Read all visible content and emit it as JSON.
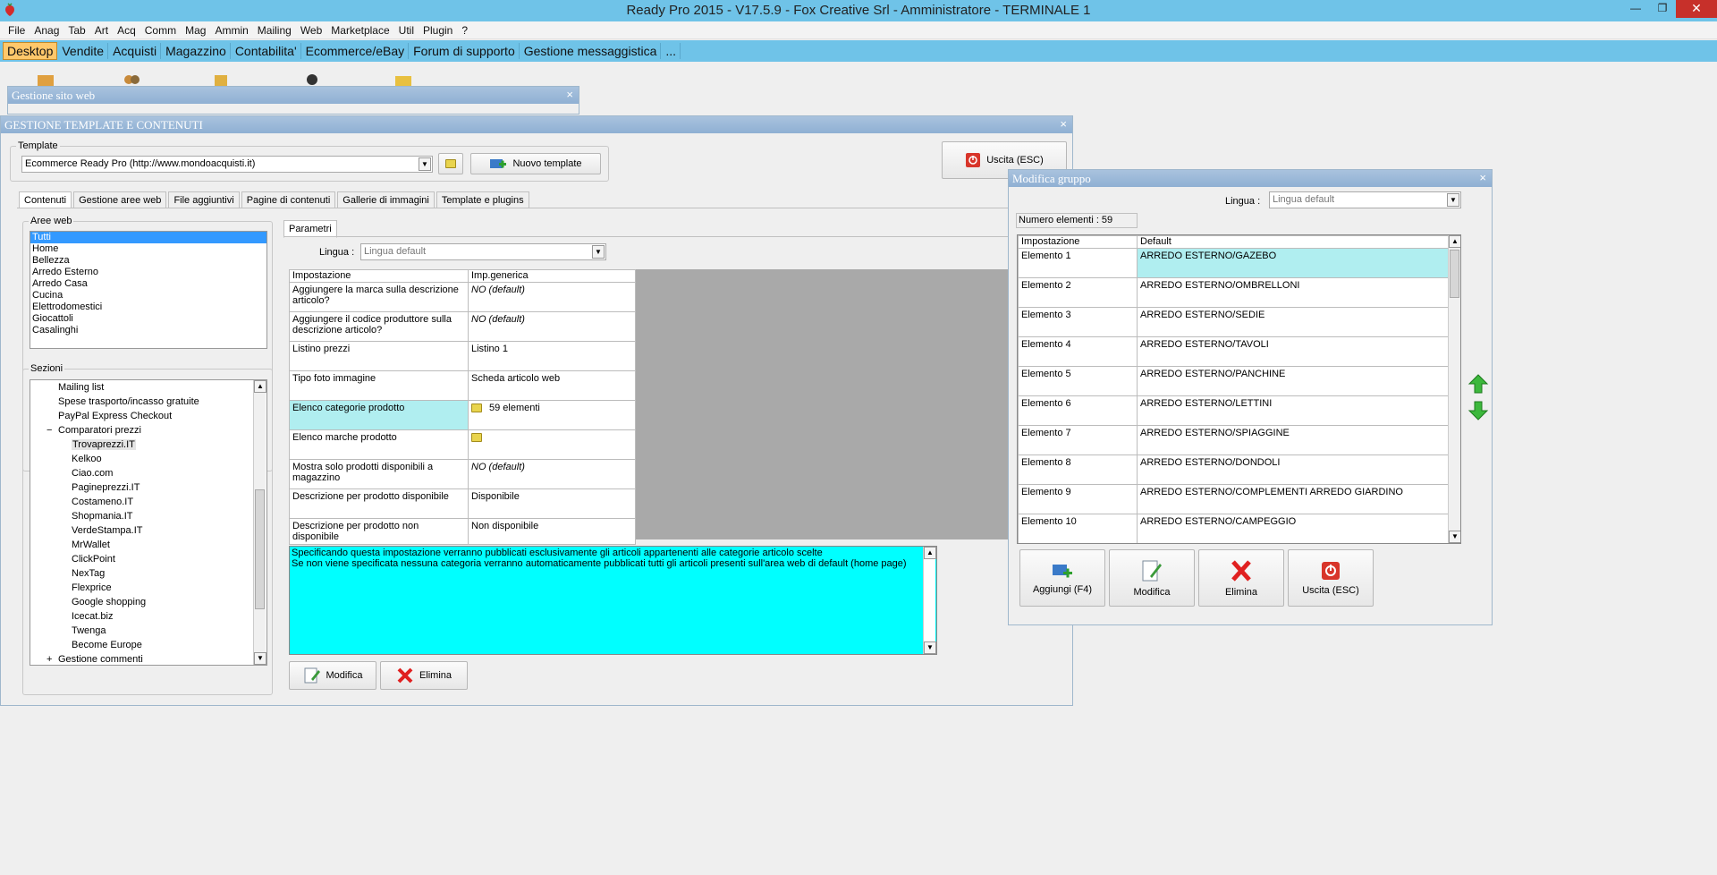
{
  "app": {
    "title": "Ready Pro 2015 - V17.5.9 - Fox Creative Srl - Amministratore - TERMINALE 1",
    "window_buttons": [
      "—",
      "❐",
      "✕"
    ]
  },
  "menu": [
    "File",
    "Anag",
    "Tab",
    "Art",
    "Acq",
    "Comm",
    "Mag",
    "Ammin",
    "Mailing",
    "Web",
    "Marketplace",
    "Util",
    "Plugin",
    "?"
  ],
  "tabs": [
    "Desktop",
    "Vendite",
    "Acquisti",
    "Magazzino",
    "Contabilita'",
    "Ecommerce/eBay",
    "Forum di supporto",
    "Gestione messaggistica",
    "..."
  ],
  "sito_web": {
    "title": "Gestione sito web",
    "close": "×"
  },
  "main_window": {
    "title": "GESTIONE TEMPLATE E CONTENUTI",
    "close": "×",
    "template_group_label": "Template",
    "template_value": "Ecommerce Ready Pro (http://www.mondoacquisti.it)",
    "nuovo_template": "Nuovo template",
    "uscita": "Uscita (ESC)",
    "subtabs": [
      "Contenuti",
      "Gestione aree web",
      "File aggiuntivi",
      "Pagine di contenuti",
      "Gallerie di immagini",
      "Template e plugins"
    ],
    "aree_web_label": "Aree web",
    "aree_web": [
      "Tutti",
      "Home",
      "Bellezza",
      "Arredo Esterno",
      "Arredo Casa",
      "Cucina",
      "Elettrodomestici",
      "Giocattoli",
      "Casalinghi"
    ],
    "sezioni_label": "Sezioni",
    "sezioni": [
      {
        "label": "Mailing list",
        "level": 1
      },
      {
        "label": "Spese trasporto/incasso gratuite",
        "level": 1
      },
      {
        "label": "PayPal Express Checkout",
        "level": 1
      },
      {
        "label": "Comparatori prezzi",
        "level": 1,
        "expander": "−"
      },
      {
        "label": "Trovaprezzi.IT",
        "level": 2,
        "selected": true
      },
      {
        "label": "Kelkoo",
        "level": 2
      },
      {
        "label": "Ciao.com",
        "level": 2
      },
      {
        "label": "Pagineprezzi.IT",
        "level": 2
      },
      {
        "label": "Costameno.IT",
        "level": 2
      },
      {
        "label": "Shopmania.IT",
        "level": 2
      },
      {
        "label": "VerdeStampa.IT",
        "level": 2
      },
      {
        "label": "MrWallet",
        "level": 2
      },
      {
        "label": "ClickPoint",
        "level": 2
      },
      {
        "label": "NexTag",
        "level": 2
      },
      {
        "label": "Flexprice",
        "level": 2
      },
      {
        "label": "Google shopping",
        "level": 2
      },
      {
        "label": "Icecat.biz",
        "level": 2
      },
      {
        "label": "Twenga",
        "level": 2
      },
      {
        "label": "Become Europe",
        "level": 2
      },
      {
        "label": "Gestione commenti",
        "level": 1,
        "expander": "+"
      }
    ],
    "parametri_tab": "Parametri",
    "lingua_label": "Lingua :",
    "lingua_value": "Lingua default",
    "param_headers": [
      "Impostazione",
      "Imp.generica"
    ],
    "params": [
      {
        "name": "Aggiungere la marca sulla descrizione articolo?",
        "value": "NO (default)",
        "italic": true
      },
      {
        "name": "Aggiungere il codice produttore sulla descrizione articolo?",
        "value": "NO (default)",
        "italic": true
      },
      {
        "name": "Listino prezzi",
        "value": "Listino 1"
      },
      {
        "name": "Tipo foto immagine",
        "value": "Scheda articolo web"
      },
      {
        "name": "Elenco categorie prodotto",
        "value": "59 elementi",
        "folder": true,
        "highlight": true
      },
      {
        "name": "Elenco marche prodotto",
        "value": "",
        "folder": true
      },
      {
        "name": "Mostra solo prodotti disponibili a magazzino",
        "value": "NO (default)",
        "italic": true
      },
      {
        "name": "Descrizione per prodotto disponibile",
        "value": "Disponibile"
      },
      {
        "name": "Descrizione per prodotto non disponibile",
        "value": "Non disponibile"
      }
    ],
    "help_line1": "Specificando questa impostazione verranno pubblicati esclusivamente gli articoli appartenenti alle categorie articolo scelte",
    "help_line2": "Se non viene specificata nessuna categoria verranno automaticamente pubblicati tutti gli articoli presenti sull'area web di default (home page)",
    "modifica": "Modifica",
    "elimina": "Elimina"
  },
  "group_window": {
    "title": "Modifica gruppo",
    "close": "×",
    "lingua_label": "Lingua :",
    "lingua_value": "Lingua default",
    "count": "Numero elementi : 59",
    "headers": [
      "Impostazione",
      "Default"
    ],
    "rows": [
      {
        "name": "Elemento 1",
        "value": "ARREDO ESTERNO/GAZEBO"
      },
      {
        "name": "Elemento 2",
        "value": "ARREDO ESTERNO/OMBRELLONI"
      },
      {
        "name": "Elemento 3",
        "value": "ARREDO ESTERNO/SEDIE"
      },
      {
        "name": "Elemento 4",
        "value": "ARREDO ESTERNO/TAVOLI"
      },
      {
        "name": "Elemento 5",
        "value": "ARREDO ESTERNO/PANCHINE"
      },
      {
        "name": "Elemento 6",
        "value": "ARREDO ESTERNO/LETTINI"
      },
      {
        "name": "Elemento 7",
        "value": "ARREDO ESTERNO/SPIAGGINE"
      },
      {
        "name": "Elemento 8",
        "value": "ARREDO ESTERNO/DONDOLI"
      },
      {
        "name": "Elemento 9",
        "value": "ARREDO ESTERNO/COMPLEMENTI ARREDO GIARDINO"
      },
      {
        "name": "Elemento 10",
        "value": "ARREDO ESTERNO/CAMPEGGIO"
      }
    ],
    "buttons": [
      "Aggiungi (F4)",
      "Modifica",
      "Elimina",
      "Uscita (ESC)"
    ]
  },
  "colors": {
    "titlebar": "#6fc3e8",
    "active_tab": "#ffc86b",
    "help_bg": "#00ffff",
    "selected_cell": "#b0eef0"
  }
}
